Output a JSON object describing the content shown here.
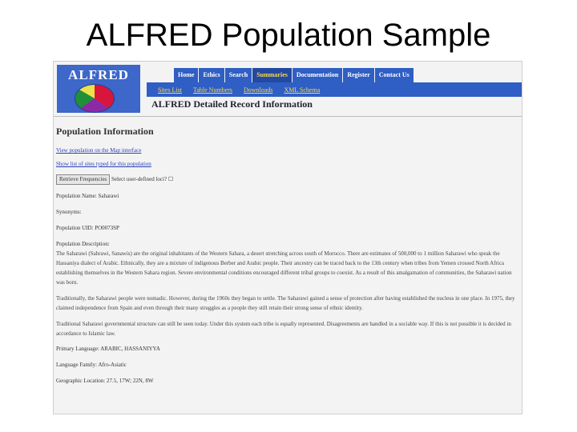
{
  "slide": {
    "title": "ALFRED Population Sample"
  },
  "logo": {
    "text": "ALFRED"
  },
  "nav": {
    "tabs": [
      "Home",
      "Ethics",
      "Search",
      "Summaries",
      "Documentation",
      "Register",
      "Contact Us"
    ],
    "active": "Summaries",
    "subnav": [
      "Sites List",
      "Table Numbers",
      "Downloads",
      "XML Schema"
    ]
  },
  "page": {
    "heading": "ALFRED Detailed Record Information",
    "section_title": "Population Information",
    "links": {
      "map": "View population on the Map interface",
      "sites": "Show list of sites typed for this population"
    },
    "frequencies_button": "Retrieve Frequencies",
    "frequencies_note": "Select user-defined loci?",
    "fields": {
      "population_name": "Population Name: Saharawi",
      "synonyms": "Synonyms:",
      "population_uid": "Population UID: PO0073SP",
      "description_label": "Population Description:",
      "description_1": "The Saharawi (Sahrawi, Sanawis) are the original inhabitants of the Western Sahara, a desert stretching across south of Morocco. There are estimates of 500,000 to 1 million Saharawi who speak the Hassaniya dialect of Arabic. Ethnically, they are a mixture of indigenous Berber and Arabic people. Their ancestry can be traced back to the 13th century when tribes from Yemen crossed North Africa establishing themselves in the Western Sahara region. Severe environmental conditions encouraged different tribal groups to coexist. As a result of this amalgamation of communities, the Saharawi nation was born.",
      "description_2": "Traditionally, the Saharawi people were nomadic. However, during the 1960s they began to settle. The Saharawi gained a sense of protection after having established the nucleus in one place. In 1975, they claimed independence from Spain and even through their many struggles as a people they still retain their strong sense of ethnic identity.",
      "description_3": "Traditional Saharawi governmental structure can still be seen today. Under this system each tribe is equally represented. Disagreements are handled in a sociable way. If this is not possible it is decided in accordance to Islamic law.",
      "primary_language": "Primary Language: ARABIC, HASSANIYYA",
      "language_family": "Language Family: Afro-Asiatic",
      "geographic_location": "Geographic Location: 27.5, 17W; 22N, 8W"
    }
  }
}
